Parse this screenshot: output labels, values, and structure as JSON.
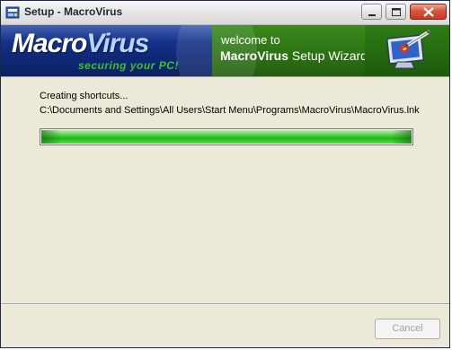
{
  "window": {
    "title": "Setup - MacroVirus"
  },
  "banner": {
    "brand_a": "Macro",
    "brand_b": "Virus",
    "tagline": "securing your PC!",
    "welcome_line1": "welcome to",
    "welcome_brand": "MacroVirus",
    "welcome_rest": " Setup Wizard"
  },
  "install": {
    "status": "Creating shortcuts...",
    "detail": "C:\\Documents and Settings\\All Users\\Start Menu\\Programs\\MacroVirus\\MacroVirus.lnk",
    "progress_percent": 100
  },
  "footer": {
    "cancel_label": "Cancel",
    "cancel_enabled": false
  },
  "icons": {
    "app": "setup-app-icon",
    "minimize": "minimize-icon",
    "maximize": "maximize-icon",
    "close": "close-icon",
    "banner": "monitor-syringe-icon"
  },
  "colors": {
    "banner_blue": "#0f2a7a",
    "banner_green": "#2d7214",
    "tagline_green": "#39c12e",
    "progress_green": "#20b41a",
    "close_red": "#c33a22"
  }
}
